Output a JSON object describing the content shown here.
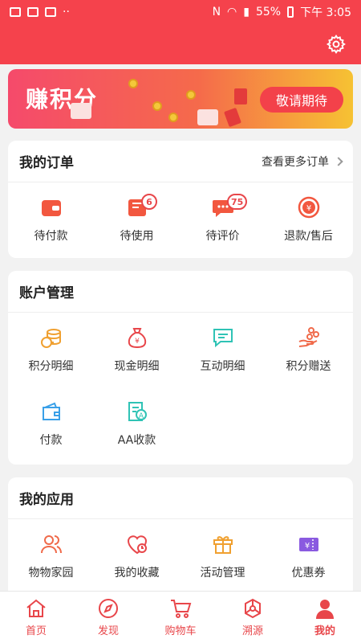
{
  "status": {
    "battery": "55%",
    "time": "下午 3:05"
  },
  "banner": {
    "title": "赚积分",
    "button": "敬请期待"
  },
  "orders": {
    "title": "我的订单",
    "more": "查看更多订单",
    "items": [
      {
        "label": "待付款",
        "icon": "wallet-icon"
      },
      {
        "label": "待使用",
        "icon": "ticket-icon",
        "badge": "6"
      },
      {
        "label": "待评价",
        "icon": "comment-icon",
        "badge": "75"
      },
      {
        "label": "退款/售后",
        "icon": "refund-icon"
      }
    ]
  },
  "account": {
    "title": "账户管理",
    "items": [
      {
        "label": "积分明细",
        "icon": "coins-icon"
      },
      {
        "label": "现金明细",
        "icon": "money-bag-icon"
      },
      {
        "label": "互动明细",
        "icon": "chat-icon"
      },
      {
        "label": "积分赠送",
        "icon": "gift-hand-icon"
      },
      {
        "label": "付款",
        "icon": "wallet-pay-icon"
      },
      {
        "label": "AA收款",
        "icon": "aa-collect-icon"
      }
    ]
  },
  "apps": {
    "title": "我的应用",
    "items": [
      {
        "label": "物物家园",
        "icon": "users-icon"
      },
      {
        "label": "我的收藏",
        "icon": "heart-icon"
      },
      {
        "label": "活动管理",
        "icon": "gift-box-icon"
      },
      {
        "label": "优惠券",
        "icon": "coupon-icon"
      }
    ]
  },
  "tabs": [
    {
      "label": "首页",
      "icon": "home-icon"
    },
    {
      "label": "发现",
      "icon": "compass-icon"
    },
    {
      "label": "购物车",
      "icon": "cart-icon"
    },
    {
      "label": "溯源",
      "icon": "trace-icon"
    },
    {
      "label": "我的",
      "icon": "user-icon",
      "active": true
    }
  ],
  "colors": {
    "brand": "#f5424c",
    "accent": "#e8464a",
    "orange": "#f0a030",
    "teal": "#2fc3b5",
    "blue": "#3aa0e8",
    "purple": "#8a5ae0"
  }
}
